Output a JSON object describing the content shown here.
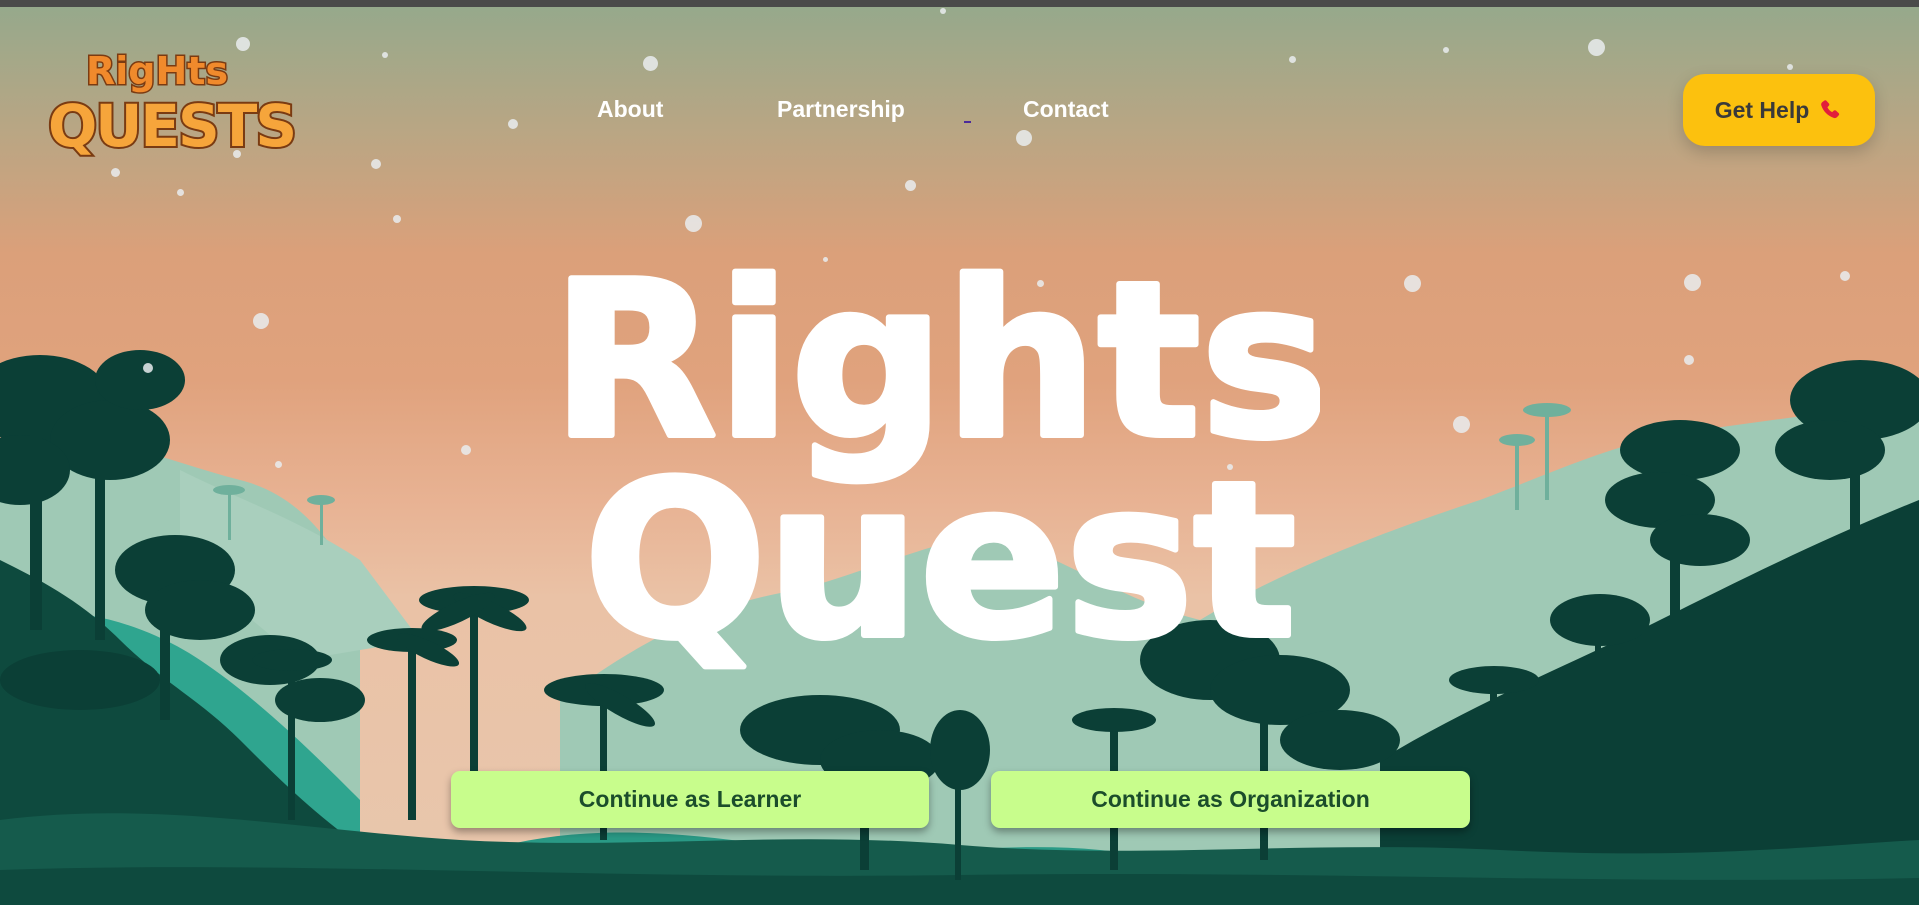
{
  "brand": {
    "logo_line1": "RigHts",
    "logo_line2": "QUESTS"
  },
  "nav": {
    "about": "About",
    "partnership": "Partnership",
    "contact": "Contact"
  },
  "header": {
    "get_help_label": "Get Help",
    "get_help_icon": "phone-icon"
  },
  "hero": {
    "title_line1": "Rights",
    "title_line2": "Quest"
  },
  "actions": {
    "learner_label": "Continue as Learner",
    "organization_label": "Continue as Organization"
  },
  "colors": {
    "sky_top": "#94a98c",
    "sky_mid": "#e0a27d",
    "hill_light": "#9fc9b5",
    "forest_dark": "#0b3f36",
    "forest_mid": "#155b4c",
    "teal": "#2fa58f",
    "button_green": "#c8fd8c",
    "help_yellow": "#fcc10e",
    "logo_orange": "#f08a2c"
  }
}
